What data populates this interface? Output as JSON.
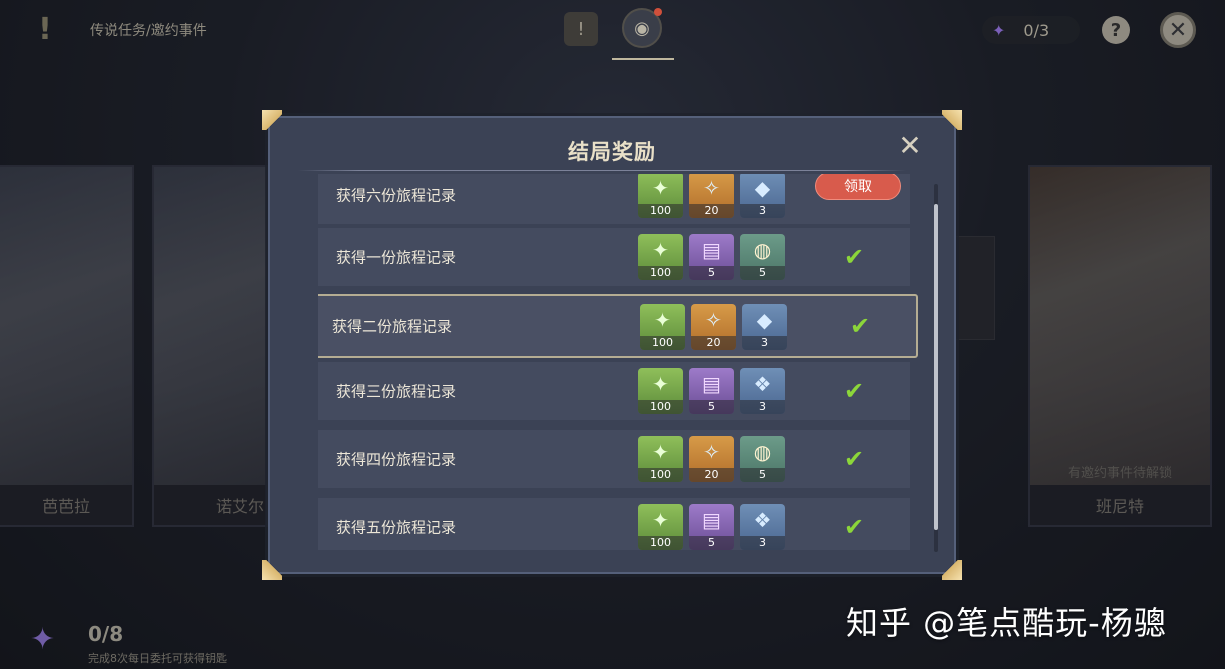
{
  "header": {
    "breadcrumb": "传说任务/邀约事件",
    "keys_count": "0/3",
    "help_label": "?",
    "close_label": "✕"
  },
  "characters": [
    {
      "name": "芭芭拉"
    },
    {
      "name": "诺艾尔"
    },
    {
      "name": "班尼特",
      "status": "有邀约事件待解锁"
    }
  ],
  "footer": {
    "keys_progress": "0/8",
    "keys_hint": "完成8次每日委托可获得钥匙"
  },
  "watermark": "知乎 @笔点酷玩-杨骢",
  "modal": {
    "title": "结局奖励",
    "close_label": "✕",
    "claim_label": "领取",
    "check_glyph": "✔",
    "rows": [
      {
        "label": "获得六份旅程记录",
        "status": "claim",
        "items": [
          {
            "icon": "adventure-exp-icon",
            "qty": "100",
            "color": "green"
          },
          {
            "icon": "primogem-icon",
            "qty": "20",
            "color": "orange"
          },
          {
            "icon": "mystic-ore-icon",
            "qty": "3",
            "color": "blue"
          }
        ]
      },
      {
        "label": "获得一份旅程记录",
        "status": "claimed",
        "items": [
          {
            "icon": "adventure-exp-icon",
            "qty": "100",
            "color": "green"
          },
          {
            "icon": "exp-book-icon",
            "qty": "5",
            "color": "purple"
          },
          {
            "icon": "dish-icon",
            "qty": "5",
            "color": "teal"
          }
        ]
      },
      {
        "label": "获得二份旅程记录",
        "status": "claimed",
        "selected": true,
        "items": [
          {
            "icon": "adventure-exp-icon",
            "qty": "100",
            "color": "green"
          },
          {
            "icon": "primogem-icon",
            "qty": "20",
            "color": "orange"
          },
          {
            "icon": "mystic-ore-icon",
            "qty": "3",
            "color": "blue"
          }
        ]
      },
      {
        "label": "获得三份旅程记录",
        "status": "claimed",
        "items": [
          {
            "icon": "adventure-exp-icon",
            "qty": "100",
            "color": "green"
          },
          {
            "icon": "exp-book-icon",
            "qty": "5",
            "color": "purple"
          },
          {
            "icon": "crystal-icon",
            "qty": "3",
            "color": "blue"
          }
        ]
      },
      {
        "label": "获得四份旅程记录",
        "status": "claimed",
        "items": [
          {
            "icon": "adventure-exp-icon",
            "qty": "100",
            "color": "green"
          },
          {
            "icon": "primogem-icon",
            "qty": "20",
            "color": "orange"
          },
          {
            "icon": "dish-icon",
            "qty": "5",
            "color": "teal"
          }
        ]
      },
      {
        "label": "获得五份旅程记录",
        "status": "claimed",
        "items": [
          {
            "icon": "adventure-exp-icon",
            "qty": "100",
            "color": "green"
          },
          {
            "icon": "exp-book-icon",
            "qty": "5",
            "color": "purple"
          },
          {
            "icon": "crystal-icon",
            "qty": "3",
            "color": "blue"
          }
        ]
      }
    ]
  }
}
